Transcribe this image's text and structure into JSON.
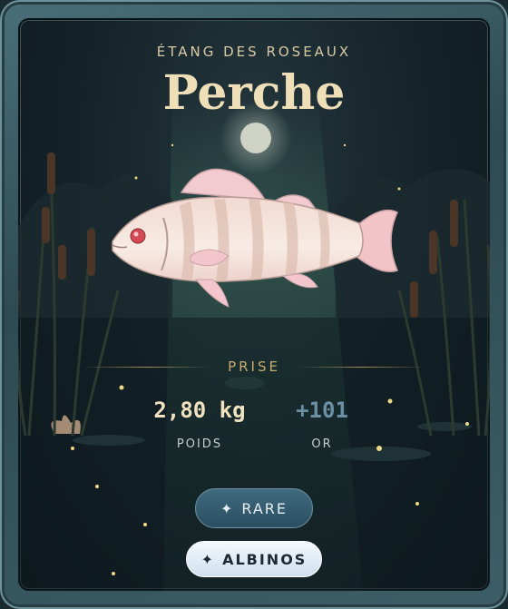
{
  "location": "ÉTANG DES ROSEAUX",
  "fish_name": "Perche",
  "catch_section": {
    "label": "PRISE",
    "weight": {
      "value": "2,80 kg",
      "label": "POIDS"
    },
    "gold": {
      "value": "+101",
      "label": "OR"
    }
  },
  "badges": {
    "rare": {
      "icon": "✦",
      "label": "RARE"
    },
    "albinos": {
      "icon": "✦",
      "label": "ALBINOS"
    }
  },
  "colors": {
    "title": "#efdfb9",
    "weight": "#f0e2c0",
    "gold": "#6b8fa3",
    "rare_badge": "#34596c",
    "albinos_badge": "#e4eef6"
  }
}
